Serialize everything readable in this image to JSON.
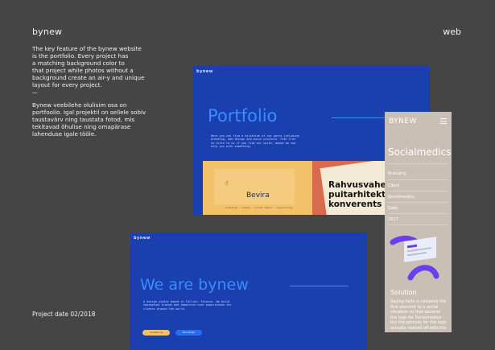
{
  "header": {
    "brand": "bynew",
    "category": "web"
  },
  "description": {
    "english": "The key feature of the bynew website\nis the portfolio. Every project has\na matching background color to\nthat project while photos without a\nbackground create an air-y and unique\nlayout for every project.",
    "separator": "—",
    "estonian": "Bynew veebilehe olulisim osa on\nportfoolio. Igal projektil on sellele sobiv\ntaustavärv ning taustata fotod, mis\ntekitavad õhulise ning omapärase\nlahenduse igale tööle."
  },
  "project_date": "Project date 02/2018",
  "mockup_portfolio": {
    "logo": "bynew",
    "title": "Portfolio",
    "intro": "Here you can find a selection of our works including branding, web design and music projects. Feel free to write to us if you like our works, maybe we can help you with something.",
    "card1_label": "Bevira",
    "card1_cursor": "☝",
    "card1_caption": "branding · visual · social media · copywriting",
    "card2_text": "Rahvusvahe\npuitarhitekt\nkonverents"
  },
  "mockup_home": {
    "logo": "bynew",
    "title": "We are bynew",
    "intro": "A design studio based in Tallinn, Estonia. We build conceptual brands and immersive user experiences for clients around the world.",
    "button_primary": "Contact us",
    "button_secondary": "Our works"
  },
  "mockup_mobile": {
    "logo": "BYNEW",
    "title": "Socialmedics",
    "meta": [
      "Branding",
      "Client",
      "Socialmedics",
      "Date",
      "2017"
    ],
    "solution_title": "Solution",
    "solution_text": "Saying hello is certainly the first element to a social situation so that became the logo for Socialmedics but the process for the logo actually started off with the"
  },
  "colors": {
    "background": "#454545",
    "mockup_blue": "#1a3fae",
    "accent_blue": "#3a8dff",
    "card_yellow": "#f2c26b",
    "card_coral": "#d86a4e",
    "mobile_beige": "#c9bfb4"
  }
}
